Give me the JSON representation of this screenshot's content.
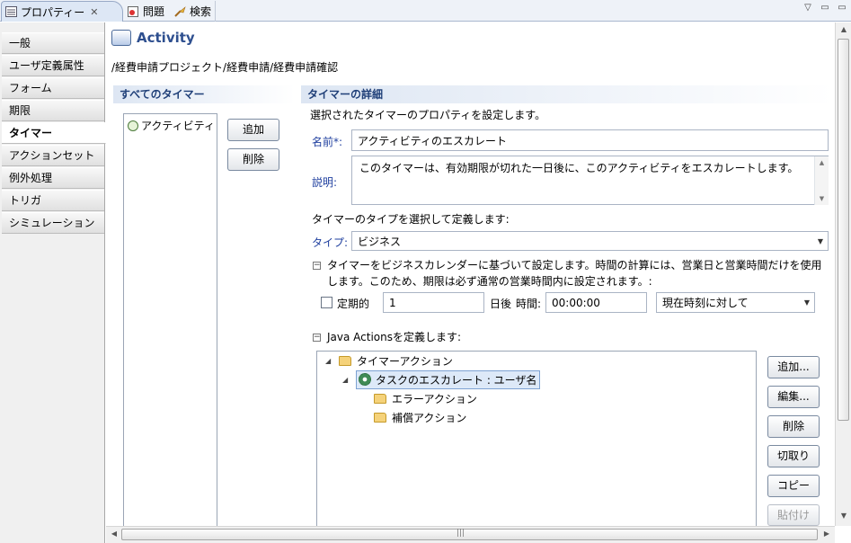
{
  "tabs": [
    {
      "label": "プロパティー",
      "close": "✕"
    },
    {
      "label": "問題"
    },
    {
      "label": "検索"
    }
  ],
  "window_controls": [
    "▽",
    "▭",
    "▭"
  ],
  "nav": [
    {
      "label": "一般"
    },
    {
      "label": "ユーザ定義属性"
    },
    {
      "label": "フォーム"
    },
    {
      "label": "期限"
    },
    {
      "label": "タイマー",
      "active": true
    },
    {
      "label": "アクションセット"
    },
    {
      "label": "例外処理"
    },
    {
      "label": "トリガ"
    },
    {
      "label": "シミュレーション"
    }
  ],
  "header": {
    "title": "Activity",
    "breadcrumb": "/経費申請プロジェクト/経費申請/経費申請確認"
  },
  "left_section": {
    "title": "すべてのタイマー",
    "items": [
      "アクティビティ"
    ],
    "add_label": "追加",
    "delete_label": "削除"
  },
  "details": {
    "title": "タイマーの詳細",
    "intro": "選択されたタイマーのプロパティを設定します。",
    "name_label": "名前*:",
    "name_value": "アクティビティのエスカレート",
    "desc_label": "説明:",
    "desc_value": "このタイマーは、有効期限が切れた一日後に、このアクティビティをエスカレートします。",
    "type_intro": "タイマーのタイプを選択して定義します:",
    "type_label": "タイプ:",
    "type_value": "ビジネス",
    "business_line1": "タイマーをビジネスカレンダーに基づいて設定します。時間の計算には、営業日と営業時間だけを使用",
    "business_line2": "します。このため、期限は必ず通常の営業時間内に設定されます。:",
    "periodic_label": "定期的",
    "periodic_checked": false,
    "days_value": "1",
    "days_after_label": "日後",
    "time_label": "時間:",
    "time_value": "00:00:00",
    "relative_value": "現在時刻に対して",
    "java_header": "Java Actionsを定義します:"
  },
  "tree": {
    "root": "タイマーアクション",
    "task": "タスクのエスカレート : ユーザ名",
    "error": "エラーアクション",
    "comp": "補償アクション"
  },
  "actions": {
    "add": "追加...",
    "edit": "編集...",
    "delete": "削除",
    "cut": "切取り",
    "copy": "コピー",
    "paste": "貼付け"
  },
  "colors": {
    "accent_text": "#1f3f78",
    "link_label": "#1f3f9f",
    "selection_bg": "#dde9f8"
  }
}
